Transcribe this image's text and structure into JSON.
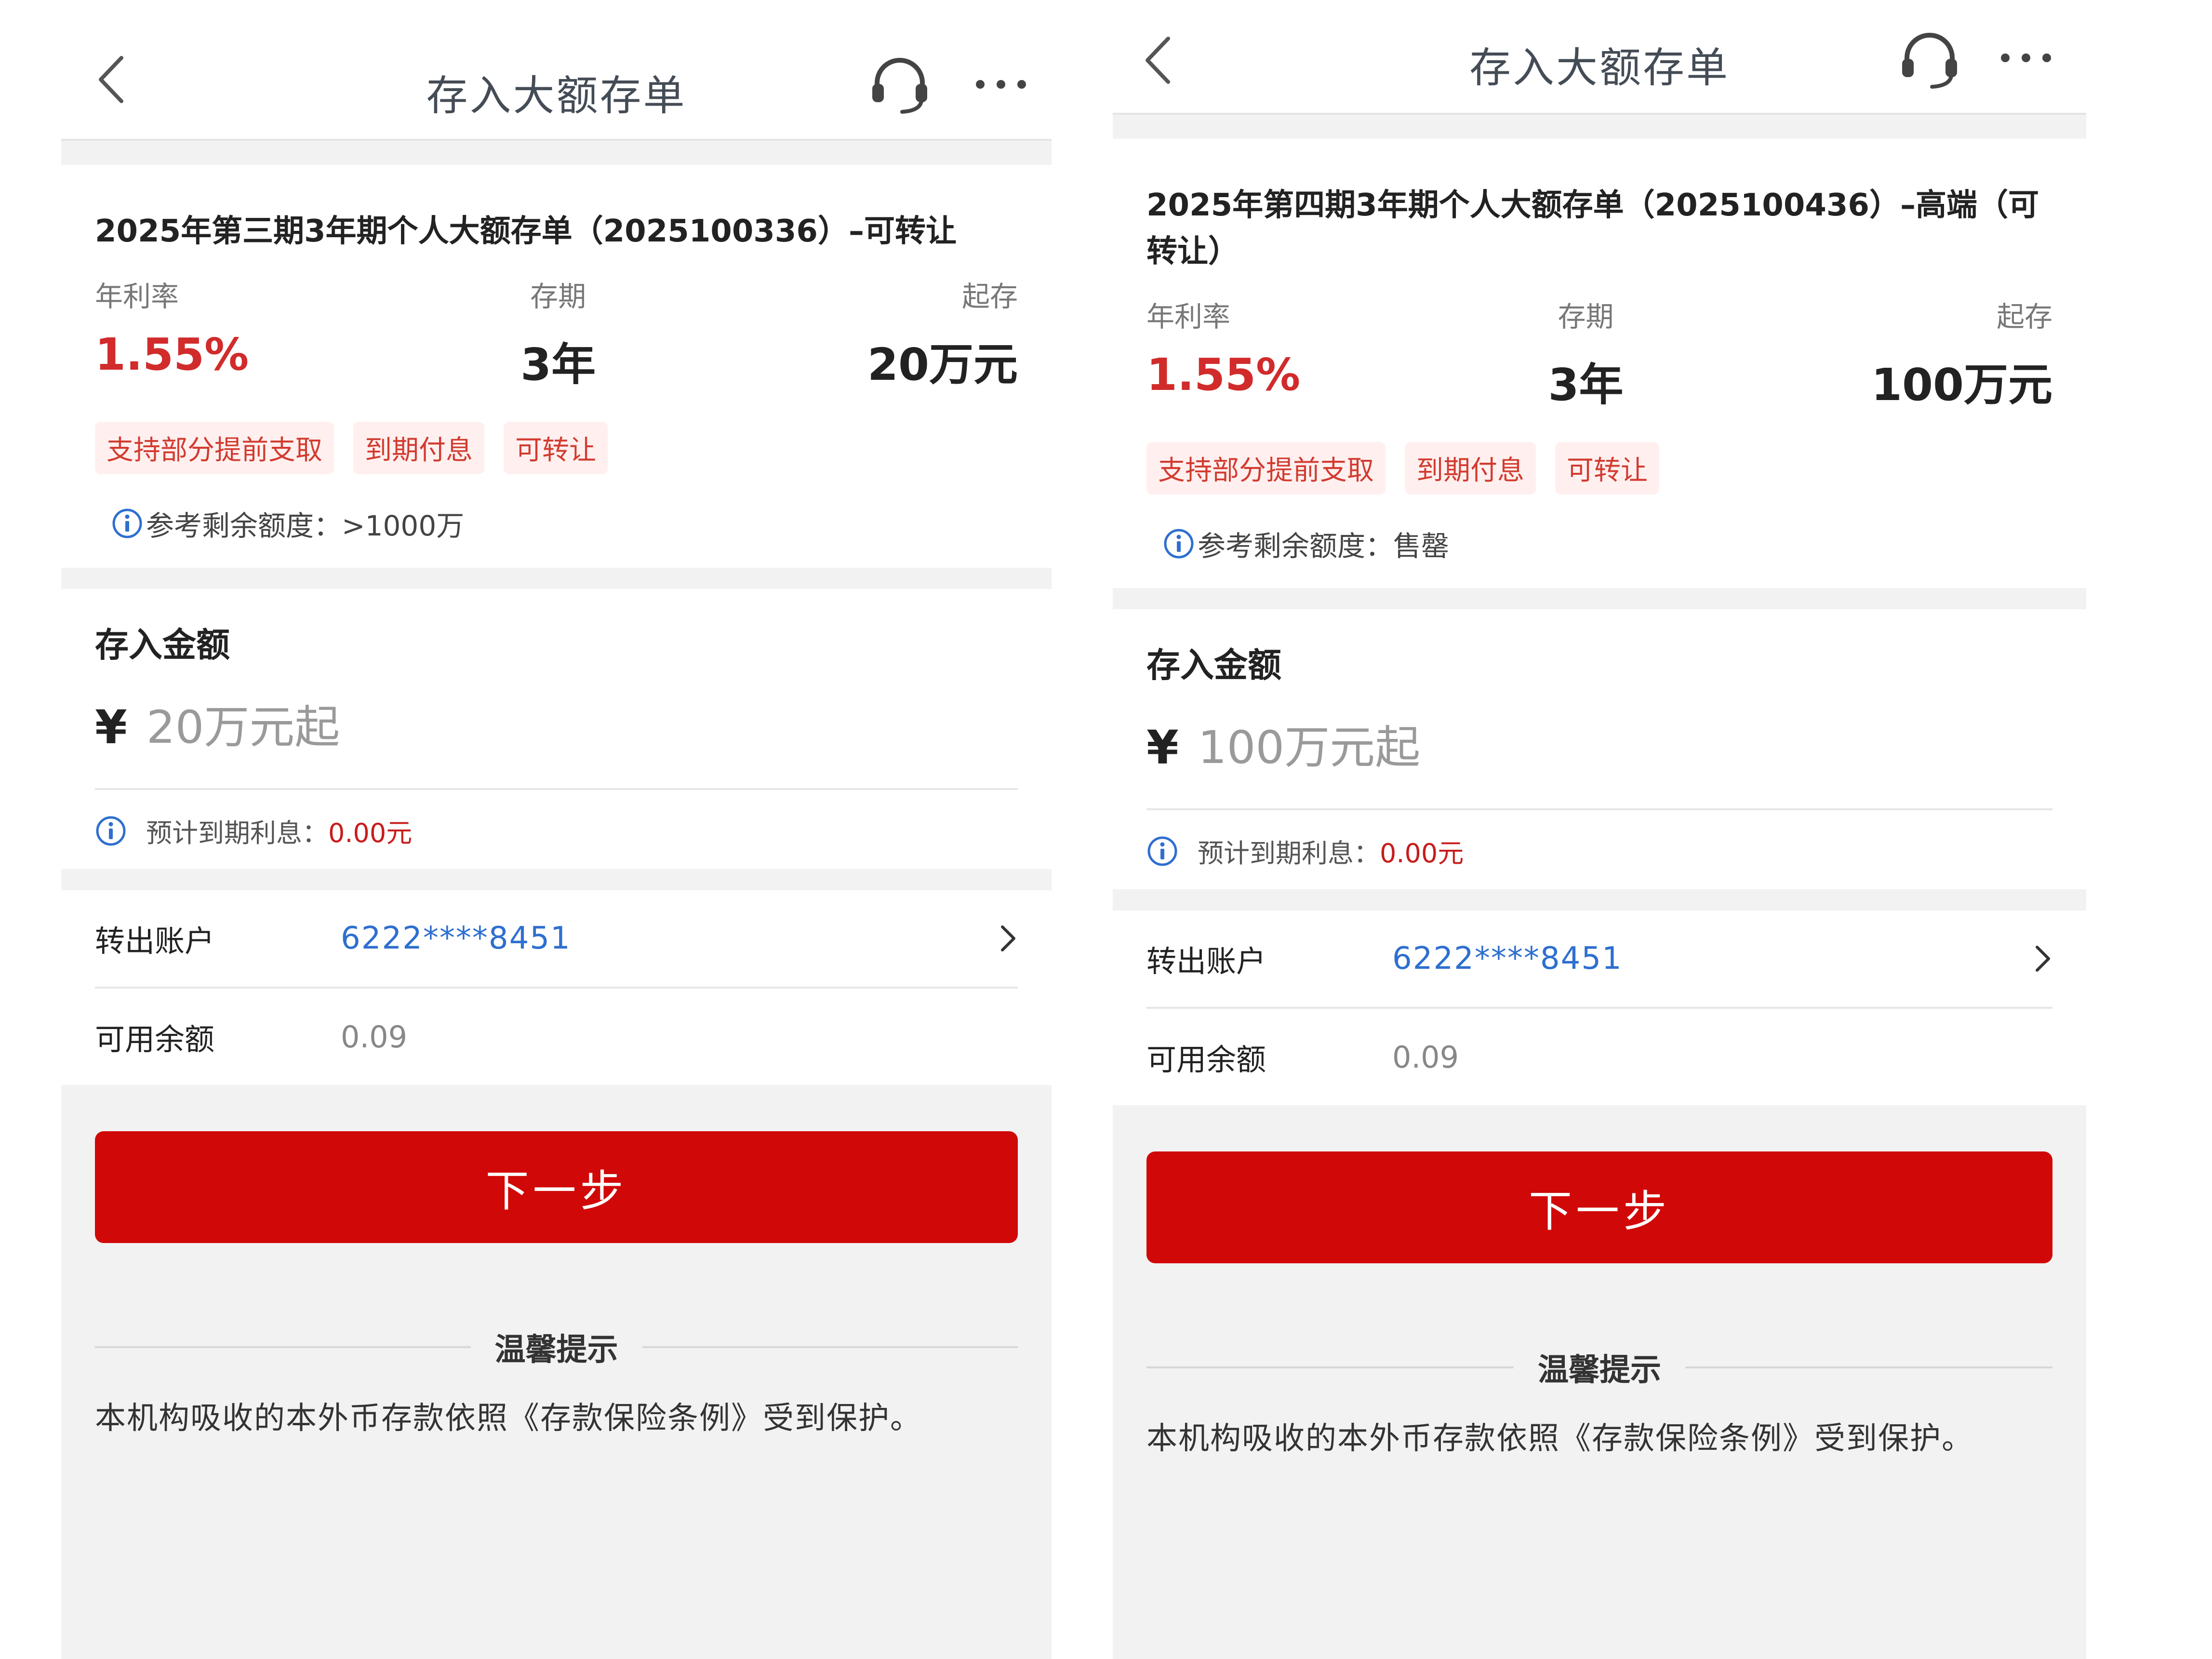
{
  "screens": [
    {
      "nav": {
        "title": "存入大额存单"
      },
      "product": {
        "title": "2025年第三期3年期个人大额存单（2025100336）–可转让",
        "rate_label": "年利率",
        "rate_value": "1.55%",
        "term_label": "存期",
        "term_value": "3年",
        "min_label": "起存",
        "min_value": "20万元",
        "tags": [
          "支持部分提前支取",
          "到期付息",
          "可转让"
        ],
        "quota_label": "参考剩余额度：",
        "quota_value": ">1000万"
      },
      "amount": {
        "title": "存入金额",
        "currency": "¥",
        "placeholder": "20万元起",
        "interest_label": "预计到期利息：",
        "interest_value": "0.00元"
      },
      "account": {
        "from_label": "转出账户",
        "from_value": "6222****8451",
        "balance_label": "可用余额",
        "balance_value": "0.09"
      },
      "next_label": "下一步",
      "tips": {
        "title": "温馨提示",
        "text": "本机构吸收的本外币存款依照《存款保险条例》受到保护。"
      }
    },
    {
      "nav": {
        "title": "存入大额存单"
      },
      "product": {
        "title": "2025年第四期3年期个人大额存单（2025100436）–高端（可转让）",
        "rate_label": "年利率",
        "rate_value": "1.55%",
        "term_label": "存期",
        "term_value": "3年",
        "min_label": "起存",
        "min_value": "100万元",
        "tags": [
          "支持部分提前支取",
          "到期付息",
          "可转让"
        ],
        "quota_label": "参考剩余额度：",
        "quota_value": "售罄"
      },
      "amount": {
        "title": "存入金额",
        "currency": "¥",
        "placeholder": "100万元起",
        "interest_label": "预计到期利息：",
        "interest_value": "0.00元"
      },
      "account": {
        "from_label": "转出账户",
        "from_value": "6222****8451",
        "balance_label": "可用余额",
        "balance_value": "0.09"
      },
      "next_label": "下一步",
      "tips": {
        "title": "温馨提示",
        "text": "本机构吸收的本外币存款依照《存款保险条例》受到保护。"
      }
    }
  ],
  "icons": {
    "back": "chevron-left-icon",
    "service": "headset-icon",
    "more": "more-dots-icon",
    "info": "info-icon",
    "row_arrow": "chevron-right-icon"
  },
  "colors": {
    "accent_red": "#d10808",
    "rate_red": "#d12b2b",
    "tag_bg": "#fff0ef",
    "tag_text": "#d23b30",
    "link_blue": "#2e6fd0",
    "page_bg": "#f2f2f2"
  }
}
